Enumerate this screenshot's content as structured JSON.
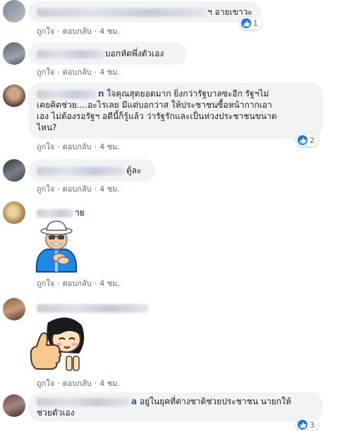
{
  "actions": {
    "like": "ถูกใจ",
    "reply": "ตอบกลับ",
    "separator": "·"
  },
  "comments": [
    {
      "name_tail": "",
      "text": "ฯ อายเขาวะ",
      "time": "4 ชม.",
      "reactions": "1"
    },
    {
      "name_tail": "",
      "text": "บอกหัดพึ่งตัวเอง",
      "time": "4 ชม.",
      "reactions": ""
    },
    {
      "name_tail": "n",
      "text_line1": "ใจคุณสุดยอดมาก ยิ่งกว่ารัฐบาลซะอีก รัฐฯไม่",
      "text_line2": "เคยคิดช่วย....อะไรเลย มีแต่บอกว่าส ให้ประชาชนซื้อหน้ากากเอา",
      "text_line3": "เอง ไม่ต้องรอรัฐฯ อดีนี้ก็รู้แล้ว ว่ารัฐรักและเป็นห่วงประชาชนขนาด",
      "text_line4": "ไหน?",
      "time": "4 ชม.",
      "reactions": "2"
    },
    {
      "name_tail": "",
      "text": "ตู้ละ",
      "time": "4 ชม.",
      "reactions": ""
    },
    {
      "name_tail": "าย",
      "text": "",
      "time": "4 ชม.",
      "reactions": "",
      "sticker": "old-man-clapping-sticker"
    },
    {
      "name_tail": "",
      "text": "",
      "time": "4 ชม.",
      "reactions": "",
      "sticker": "thumbs-up-girl-sticker"
    },
    {
      "name_tail": "a",
      "text_line1": "อยู่ในยุคที่ต่างชาติช่วยประชาชน นายกให้",
      "text_line2": "ช่วยตัวเอง",
      "time": "",
      "reactions": "3"
    }
  ],
  "colors": {
    "bubble": "#f2f3f5",
    "like_blue": "#1877f2",
    "link": "#385898",
    "meta": "#606770"
  }
}
